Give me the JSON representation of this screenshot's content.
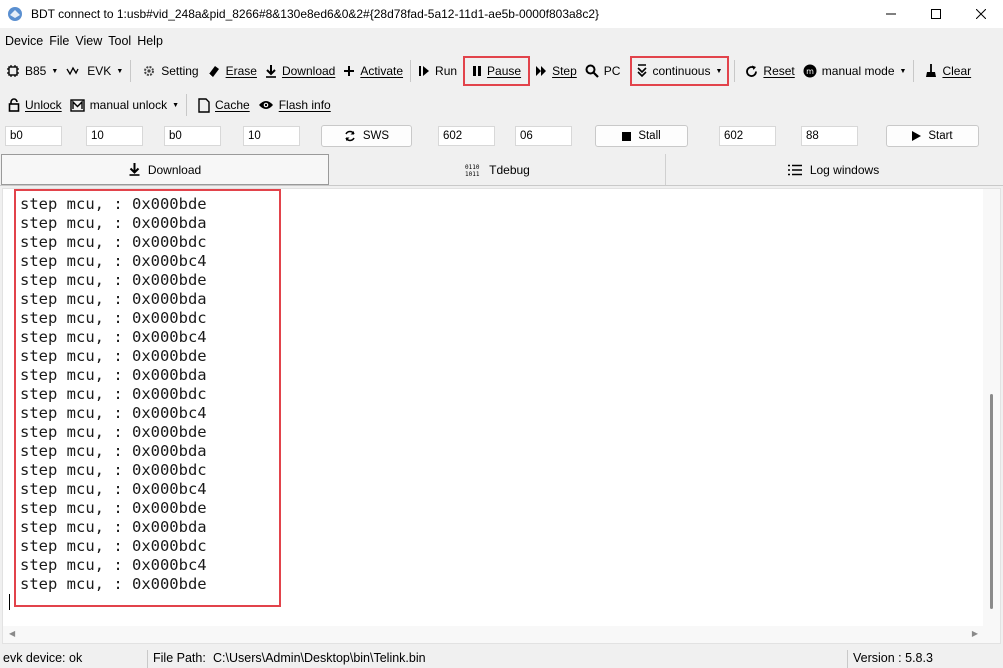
{
  "window": {
    "title": "BDT connect to 1:usb#vid_248a&pid_8266#8&130e8ed6&0&2#{28d78fad-5a12-11d1-ae5b-0000f803a8c2}",
    "controls": [
      "minimize",
      "maximize",
      "close"
    ]
  },
  "menu": [
    "Device",
    "File",
    "View",
    "Tool",
    "Help"
  ],
  "toolbar1": {
    "chip": "B85",
    "board": "EVK",
    "setting": "Setting",
    "erase": "Erase",
    "download": "Download",
    "activate": "Activate",
    "run": "Run",
    "pause": "Pause",
    "step": "Step",
    "pc": "PC",
    "mode": "continuous",
    "reset": "Reset",
    "manual_mode": "manual mode",
    "clear": "Clear"
  },
  "toolbar2": {
    "unlock": "Unlock",
    "manual_unlock": "manual unlock",
    "cache": "Cache",
    "flash_info": "Flash info"
  },
  "fields": {
    "f1": "b0",
    "f2": "10",
    "f3": "b0",
    "f4": "10",
    "sws": "SWS",
    "f5": "602",
    "f6": "06",
    "stall": "Stall",
    "f7": "602",
    "f8": "88",
    "start": "Start"
  },
  "tabs": [
    "Download",
    "Tdebug",
    "Log windows"
  ],
  "log": [
    "step mcu, : 0x000bde",
    "step mcu, : 0x000bda",
    "step mcu, : 0x000bdc",
    "step mcu, : 0x000bc4",
    "step mcu, : 0x000bde",
    "step mcu, : 0x000bda",
    "step mcu, : 0x000bdc",
    "step mcu, : 0x000bc4",
    "step mcu, : 0x000bde",
    "step mcu, : 0x000bda",
    "step mcu, : 0x000bdc",
    "step mcu, : 0x000bc4",
    "step mcu, : 0x000bde",
    "step mcu, : 0x000bda",
    "step mcu, : 0x000bdc",
    "step mcu, : 0x000bc4",
    "step mcu, : 0x000bde",
    "step mcu, : 0x000bda",
    "step mcu, : 0x000bdc",
    "step mcu, : 0x000bc4",
    "step mcu, : 0x000bde"
  ],
  "status": {
    "device": "evk device: ok",
    "file_path_label": "File Path:",
    "file_path": "C:\\Users\\Admin\\Desktop\\bin\\Telink.bin",
    "version": "Version : 5.8.3"
  },
  "colors": {
    "highlight": "#e2434b",
    "background": "#f0f0f0"
  }
}
